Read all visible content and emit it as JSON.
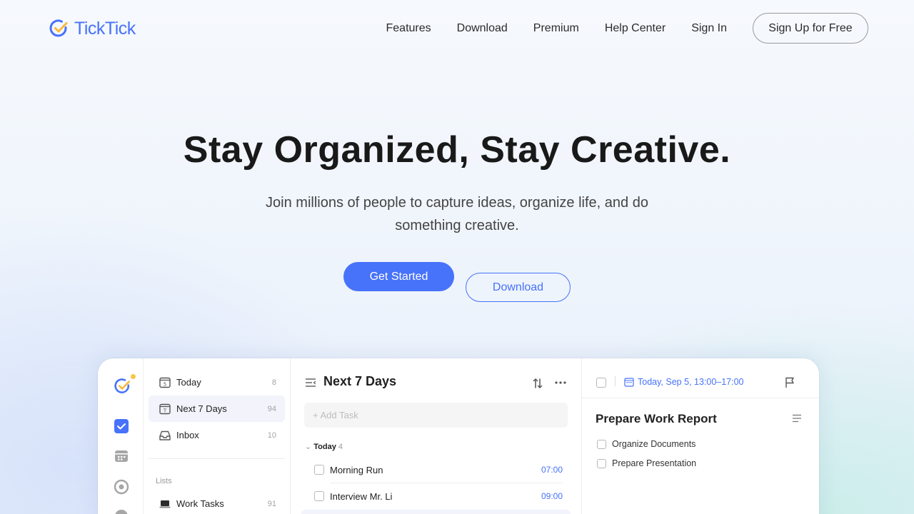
{
  "brand": {
    "name": "TickTick",
    "accent": "#4772fa"
  },
  "nav": {
    "links": [
      "Features",
      "Download",
      "Premium",
      "Help Center",
      "Sign In"
    ],
    "signup_label": "Sign Up for Free"
  },
  "hero": {
    "title": "Stay Organized, Stay Creative.",
    "subtitle": "Join millions of people to capture ideas, organize life, and do something creative.",
    "primary_cta": "Get Started",
    "secondary_cta": "Download"
  },
  "app": {
    "sidebar": [
      {
        "label": "Today",
        "count": "8",
        "icon": "calendar-day-icon"
      },
      {
        "label": "Next 7 Days",
        "count": "94",
        "icon": "calendar-week-icon",
        "active": true
      },
      {
        "label": "Inbox",
        "count": "10",
        "icon": "inbox-icon"
      }
    ],
    "lists_heading": "Lists",
    "lists": [
      {
        "label": "Work Tasks",
        "count": "91",
        "icon": "laptop-icon"
      }
    ],
    "task_panel": {
      "title": "Next 7 Days",
      "add_placeholder": "+ Add Task",
      "group": {
        "label": "Today",
        "count": "4"
      },
      "tasks": [
        {
          "title": "Morning Run",
          "time": "07:00"
        },
        {
          "title": "Interview Mr. Li",
          "time": "09:00"
        }
      ]
    },
    "detail": {
      "date": "Today, Sep 5, 13:00–17:00",
      "title": "Prepare Work Report",
      "subtasks": [
        "Organize Documents",
        "Prepare Presentation"
      ]
    }
  }
}
